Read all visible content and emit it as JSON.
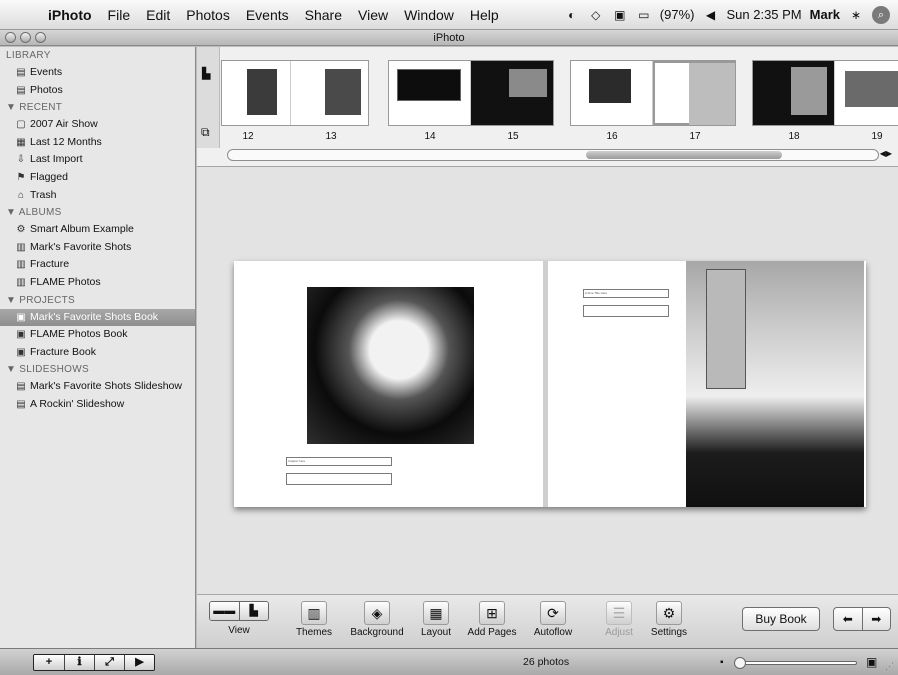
{
  "menubar": {
    "apple": "",
    "app": "iPhoto",
    "items": [
      "File",
      "Edit",
      "Photos",
      "Events",
      "Share",
      "View",
      "Window",
      "Help"
    ],
    "battery": "(97%)",
    "clock": "Sun 2:35 PM",
    "user": "Mark"
  },
  "window": {
    "title": "iPhoto"
  },
  "sidebar": {
    "sections": [
      {
        "label": "LIBRARY",
        "items": [
          {
            "label": "Events",
            "icon": "events-icon"
          },
          {
            "label": "Photos",
            "icon": "photos-icon"
          }
        ]
      },
      {
        "label": "▼ RECENT",
        "items": [
          {
            "label": "2007 Air Show",
            "icon": "event-icon"
          },
          {
            "label": "Last 12 Months",
            "icon": "calendar-icon"
          },
          {
            "label": "Last Import",
            "icon": "import-icon"
          },
          {
            "label": "Flagged",
            "icon": "flag-icon"
          },
          {
            "label": "Trash",
            "icon": "trash-icon"
          }
        ]
      },
      {
        "label": "▼ ALBUMS",
        "items": [
          {
            "label": "Smart Album Example",
            "icon": "smart-album-icon"
          },
          {
            "label": "Mark's Favorite Shots",
            "icon": "album-icon"
          },
          {
            "label": "Fracture",
            "icon": "album-icon"
          },
          {
            "label": "FLAME Photos",
            "icon": "album-icon"
          }
        ]
      },
      {
        "label": "▼ PROJECTS",
        "items": [
          {
            "label": "Mark's Favorite Shots Book",
            "icon": "book-icon",
            "selected": true
          },
          {
            "label": "FLAME Photos Book",
            "icon": "book-icon"
          },
          {
            "label": "Fracture Book",
            "icon": "book-icon"
          }
        ]
      },
      {
        "label": "▼ SLIDESHOWS",
        "items": [
          {
            "label": "Mark's Favorite Shots Slideshow",
            "icon": "slideshow-icon"
          },
          {
            "label": "A Rockin' Slideshow",
            "icon": "slideshow-icon"
          }
        ]
      }
    ]
  },
  "pages": [
    "12",
    "13",
    "14",
    "15",
    "16",
    "17",
    "18",
    "19"
  ],
  "spread": {
    "left_caption": "Caption here",
    "right_title": "A Fine Title Here"
  },
  "toolbar": {
    "view": "View",
    "themes": "Themes",
    "background": "Background",
    "layout": "Layout",
    "add_pages": "Add Pages",
    "autoflow": "Autoflow",
    "adjust": "Adjust",
    "settings": "Settings",
    "buy_book": "Buy Book"
  },
  "status": {
    "count": "26 photos"
  }
}
